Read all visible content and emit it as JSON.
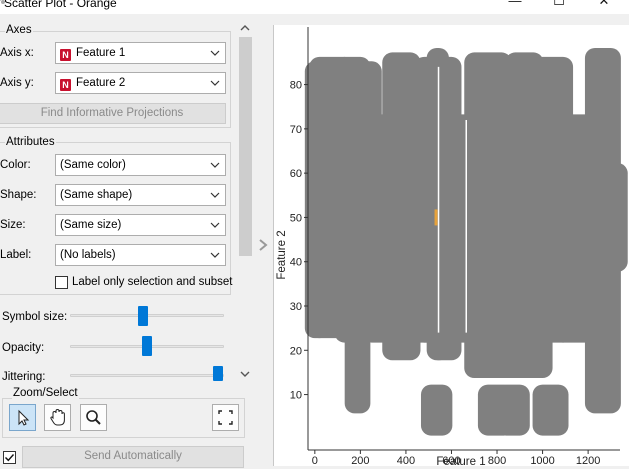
{
  "window": {
    "title": "Scatter Plot - Orange",
    "controls": [
      "minimize-icon",
      "maximize-icon",
      "close-icon"
    ]
  },
  "axes_box": {
    "title": "Axes",
    "axis_x_label": "Axis x:",
    "axis_x_value": "Feature 1",
    "axis_y_label": "Axis y:",
    "axis_y_value": "Feature 2",
    "find_button": "Find Informative Projections"
  },
  "attributes_box": {
    "title": "Attributes",
    "color_label": "Color:",
    "color_value": "(Same color)",
    "shape_label": "Shape:",
    "shape_value": "(Same shape)",
    "size_label": "Size:",
    "size_value": "(Same size)",
    "label_label": "Label:",
    "label_value": "(No labels)",
    "label_only_selection": "Label only selection and subset",
    "label_only_selection_checked": false
  },
  "sliders": {
    "symbol_size_label": "Symbol size:",
    "symbol_size_level": 0.48,
    "opacity_label": "Opacity:",
    "opacity_level": 0.5,
    "jittering_label": "Jittering:",
    "jittering_level": 1.0
  },
  "zoom_select": {
    "title": "Zoom/Select",
    "tools": [
      "select-arrow-icon",
      "pan-hand-icon",
      "zoom-magnifier-icon"
    ],
    "active_tool": "select-arrow-icon",
    "reset_icon": "reset-zoom-icon"
  },
  "footer": {
    "send_automatically": "Send Automatically",
    "send_checked": true
  },
  "colors": {
    "point": "#808080",
    "accent": "#0078d7",
    "badge": "#c8102e",
    "highlight": "#e6a23c"
  },
  "chart_data": {
    "type": "scatter",
    "title": "",
    "xlabel": "Feature 1",
    "ylabel": "Feature 2",
    "xlim": [
      -30,
      1340
    ],
    "ylim": [
      2,
      93
    ],
    "xticks": [
      0,
      200,
      400,
      600,
      800,
      1000,
      1200
    ],
    "yticks": [
      10,
      20,
      30,
      40,
      50,
      60,
      70,
      80
    ],
    "grid": false,
    "legend": "none",
    "series": [
      {
        "point_color": "#808080",
        "column_bands": [
          {
            "x_from": 0,
            "x_to": 20,
            "y_from": 25,
            "y_to": 83
          },
          {
            "x_from": 20,
            "x_to": 130,
            "y_from": 25,
            "y_to": 84
          },
          {
            "x_from": 130,
            "x_to": 200,
            "y_from": 24,
            "y_to": 84
          },
          {
            "x_from": 175,
            "x_to": 200,
            "y_from": 8,
            "y_to": 24
          },
          {
            "x_from": 200,
            "x_to": 250,
            "y_from": 25,
            "y_to": 83
          },
          {
            "x_from": 250,
            "x_to": 330,
            "y_from": 24,
            "y_to": 71
          },
          {
            "x_from": 340,
            "x_to": 420,
            "y_from": 20,
            "y_to": 85
          },
          {
            "x_from": 420,
            "x_to": 530,
            "y_from": 24,
            "y_to": 71
          },
          {
            "x_from": 480,
            "x_to": 520,
            "y_from": 24,
            "y_to": 84
          },
          {
            "x_from": 535,
            "x_to": 545,
            "y_from": 20,
            "y_to": 86
          },
          {
            "x_from": 545,
            "x_to": 600,
            "y_from": 20,
            "y_to": 84
          },
          {
            "x_from": 600,
            "x_to": 690,
            "y_from": 24,
            "y_to": 71
          },
          {
            "x_from": 700,
            "x_to": 820,
            "y_from": 16,
            "y_to": 85
          },
          {
            "x_from": 820,
            "x_to": 1000,
            "y_from": 16,
            "y_to": 71
          },
          {
            "x_from": 880,
            "x_to": 960,
            "y_from": 16,
            "y_to": 85
          },
          {
            "x_from": 1000,
            "x_to": 1090,
            "y_from": 24,
            "y_to": 84
          },
          {
            "x_from": 1090,
            "x_to": 1210,
            "y_from": 24,
            "y_to": 71
          },
          {
            "x_from": 1230,
            "x_to": 1300,
            "y_from": 8,
            "y_to": 86
          },
          {
            "x_from": 1300,
            "x_to": 1330,
            "y_from": 40,
            "y_to": 60
          }
        ],
        "bottom_clusters": [
          {
            "x_from": 510,
            "x_to": 560,
            "y_from": 3,
            "y_to": 10
          },
          {
            "x_from": 760,
            "x_to": 830,
            "y_from": 3,
            "y_to": 10
          },
          {
            "x_from": 840,
            "x_to": 900,
            "y_from": 3,
            "y_to": 10
          },
          {
            "x_from": 1000,
            "x_to": 1070,
            "y_from": 3,
            "y_to": 10
          }
        ],
        "highlighted_point": {
          "x": 530,
          "y": 50
        }
      }
    ]
  }
}
